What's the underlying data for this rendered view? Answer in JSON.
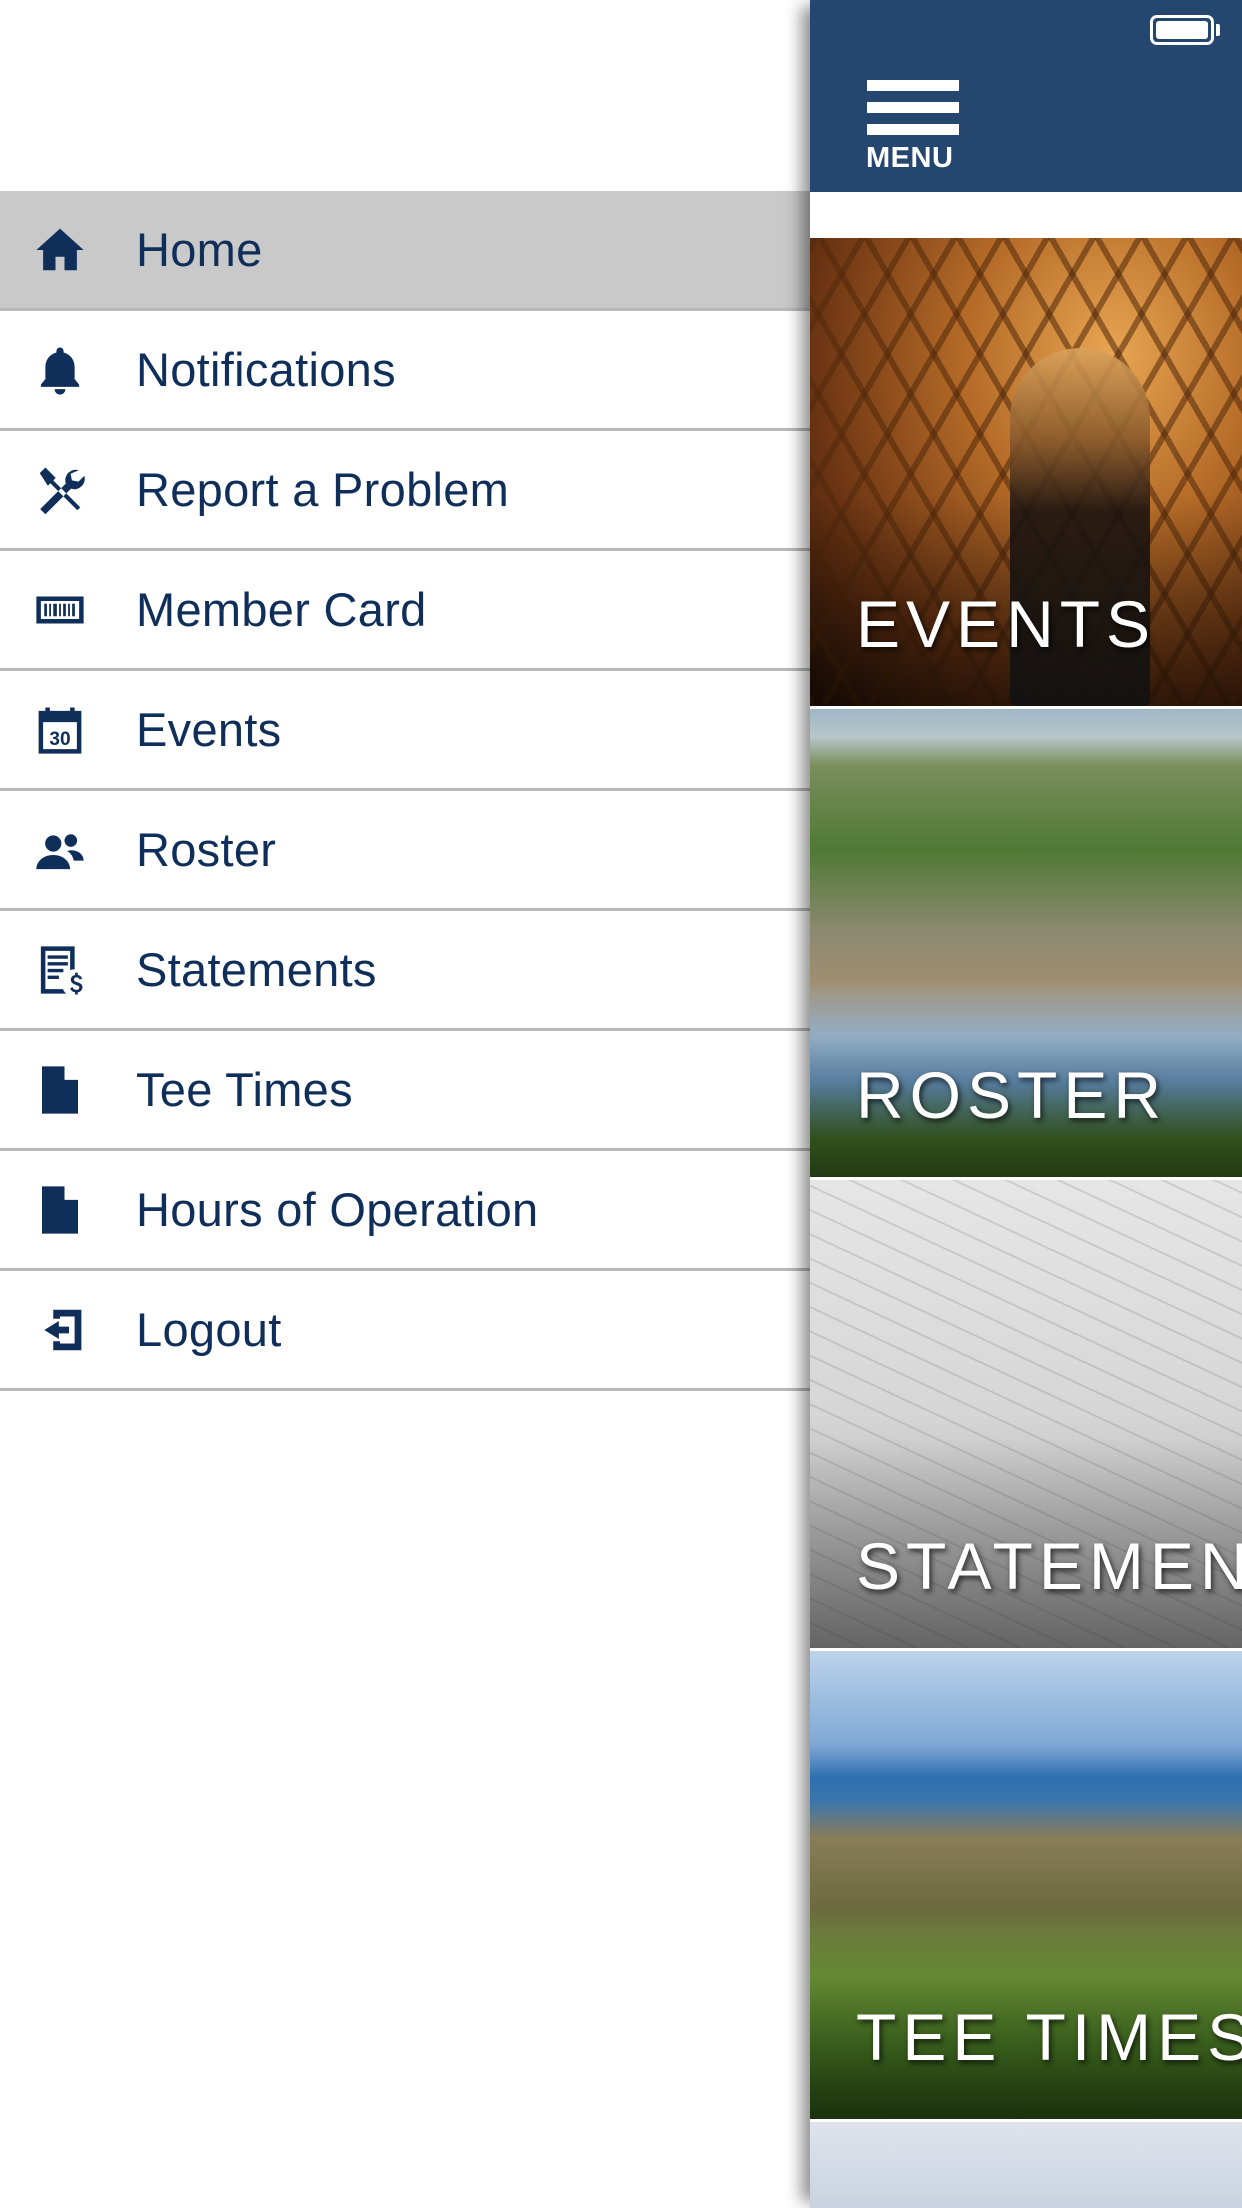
{
  "drawer": {
    "items": [
      {
        "label": "Home",
        "icon": "home-icon",
        "active": true
      },
      {
        "label": "Notifications",
        "icon": "bell-icon",
        "active": false
      },
      {
        "label": "Report a Problem",
        "icon": "tools-icon",
        "active": false
      },
      {
        "label": "Member Card",
        "icon": "barcode-card-icon",
        "active": false
      },
      {
        "label": "Events",
        "icon": "calendar-icon",
        "active": false
      },
      {
        "label": "Roster",
        "icon": "people-icon",
        "active": false
      },
      {
        "label": "Statements",
        "icon": "statement-icon",
        "active": false
      },
      {
        "label": "Tee Times",
        "icon": "document-icon",
        "active": false
      },
      {
        "label": "Hours of Operation",
        "icon": "document-icon",
        "active": false
      },
      {
        "label": "Logout",
        "icon": "logout-icon",
        "active": false
      }
    ],
    "calendar_day": "30"
  },
  "header": {
    "menu_label": "MENU",
    "battery_icon": "battery-full-icon"
  },
  "tiles": [
    {
      "label": "EVENTS"
    },
    {
      "label": "ROSTER"
    },
    {
      "label": "STATEMENTS"
    },
    {
      "label": "TEE TIMES"
    }
  ],
  "colors": {
    "brand_navy": "#25466f",
    "menu_text": "#0f2e5a",
    "active_row": "#c9c9c9",
    "divider": "#b9b9b9"
  }
}
